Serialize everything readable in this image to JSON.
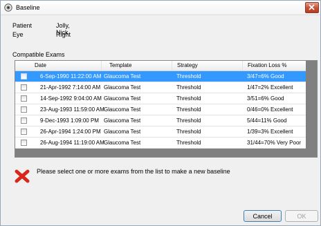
{
  "window": {
    "title": "Baseline"
  },
  "patient": {
    "label": "Patient",
    "value": "Jolly, Nick"
  },
  "eye": {
    "label": "Eye",
    "value": "Right"
  },
  "exams": {
    "label": "Compatible Exams",
    "columns": [
      "Date",
      "Template",
      "Strategy",
      "Fixation Loss %"
    ],
    "rows": [
      {
        "date": "6-Sep-1990 11:22:00 AM",
        "template": "Glaucoma Test",
        "strategy": "Threshold",
        "fixation": "3/47=6% Good",
        "selected": true
      },
      {
        "date": "21-Apr-1992 7:14:00 AM",
        "template": "Glaucoma Test",
        "strategy": "Threshold",
        "fixation": "1/47=2% Excellent"
      },
      {
        "date": "14-Sep-1992 9:04:00 AM",
        "template": "Glaucoma Test",
        "strategy": "Threshold",
        "fixation": "3/51=6% Good"
      },
      {
        "date": "23-Aug-1993 11:59:00 AM",
        "template": "Glaucoma Test",
        "strategy": "Threshold",
        "fixation": "0/46=0% Excellent"
      },
      {
        "date": "9-Dec-1993 1:09:00 PM",
        "template": "Glaucoma Test",
        "strategy": "Threshold",
        "fixation": "5/44=11% Good"
      },
      {
        "date": "26-Apr-1994 1:24:00 PM",
        "template": "Glaucoma Test",
        "strategy": "Threshold",
        "fixation": "1/39=3% Excellent"
      },
      {
        "date": "26-Aug-1994 11:19:00 AM",
        "template": "Glaucoma Test",
        "strategy": "Threshold",
        "fixation": "31/44=70% Very Poor"
      }
    ]
  },
  "message": {
    "icon": "error-x-icon",
    "text": "Please select one or more exams from the list to make a new baseline"
  },
  "buttons": {
    "cancel": "Cancel",
    "ok": "OK"
  },
  "colors": {
    "selection": "#3399ff",
    "error": "#d9261c"
  }
}
